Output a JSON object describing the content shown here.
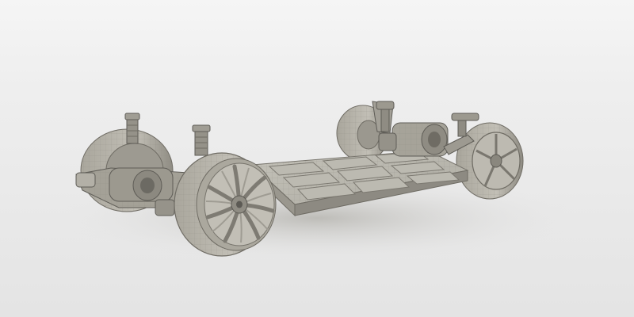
{
  "scene": {
    "subject": "ev-skateboard-chassis-clay-render",
    "colors": {
      "background_top": "#f4f4f4",
      "background_floor": "#e6e6e6",
      "clay_light": "#b9b7ae",
      "clay_mid": "#a29f95",
      "clay_dark": "#6f6c64",
      "clay_shadow": "#4f4d48"
    },
    "components": [
      "battery-pack",
      "front-left-wheel",
      "front-right-wheel",
      "rear-left-wheel",
      "rear-right-wheel",
      "front-drive-unit",
      "rear-drive-unit",
      "shock-absorber-front-left",
      "shock-absorber-front-right",
      "shock-absorber-rear-left",
      "shock-absorber-rear-right"
    ]
  }
}
